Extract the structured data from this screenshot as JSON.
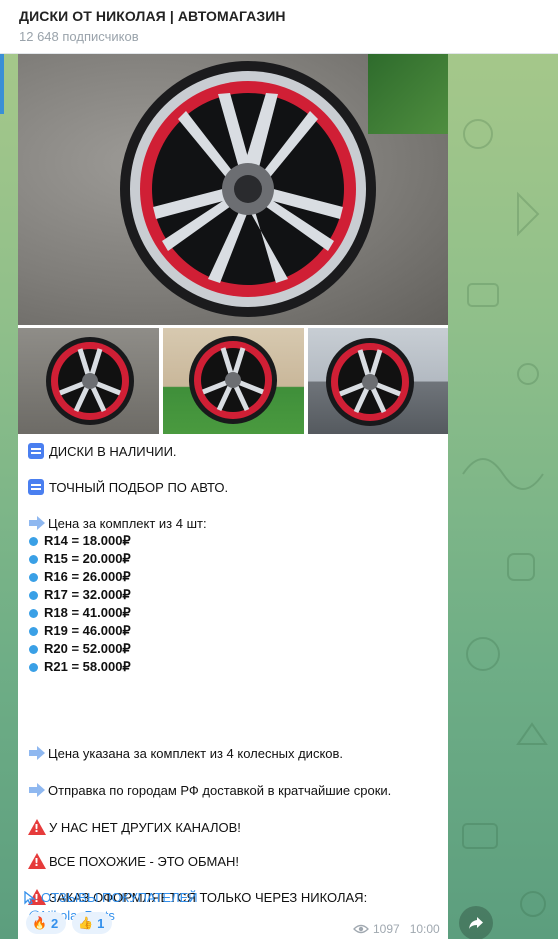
{
  "header": {
    "title": "ДИСКИ ОТ НИКОЛАЯ | АВТОМАГАЗИН",
    "subscribers": "12 648 подписчиков"
  },
  "post": {
    "photos": [
      {
        "alt_name": "main-wheel-photo"
      },
      {
        "alt_name": "thumb-1"
      },
      {
        "alt_name": "thumb-2"
      },
      {
        "alt_name": "thumb-3"
      }
    ],
    "line1": "ДИСКИ В НАЛИЧИИ.",
    "line2": "ТОЧНЫЙ ПОДБОР ПО АВТО.",
    "price_heading": "Цена за комплект из 4 шт:",
    "prices": [
      "R14 = 18.000₽",
      "R15 = 20.000₽",
      "R16 = 26.000₽",
      "R17 = 32.000₽",
      "R18 = 41.000₽",
      "R19 = 46.000₽",
      "R20 = 52.000₽",
      "R21 = 58.000₽"
    ],
    "note1": "Цена указана за комплект из 4 колесных дисков.",
    "note2": "Отправка по городам РФ доставкой в кратчайшие сроки.",
    "warn1": "У НАС НЕТ ДРУГИХ КАНАЛОВ!",
    "warn2": "ВСЕ ПОХОЖИЕ - ЭТО ОБМАН!",
    "warn3": " ЗАКАЗ ОФОРМЛЯЕТСЯ ТОЛЬКО ЧЕРЕЗ НИКОЛАЯ:",
    "contact": "@Nikola_Parts",
    "reviews_link": "ОТЗЫВЫ ПОКУПАТЕЛЕЙ",
    "reactions": [
      {
        "emoji": "🔥",
        "count": "2"
      },
      {
        "emoji": "👍",
        "count": "1"
      }
    ],
    "views": "1097",
    "time": "10:00"
  },
  "colors": {
    "accent": "#3390ec",
    "warn": "#e63b3b",
    "bubble": "#ffffff"
  }
}
